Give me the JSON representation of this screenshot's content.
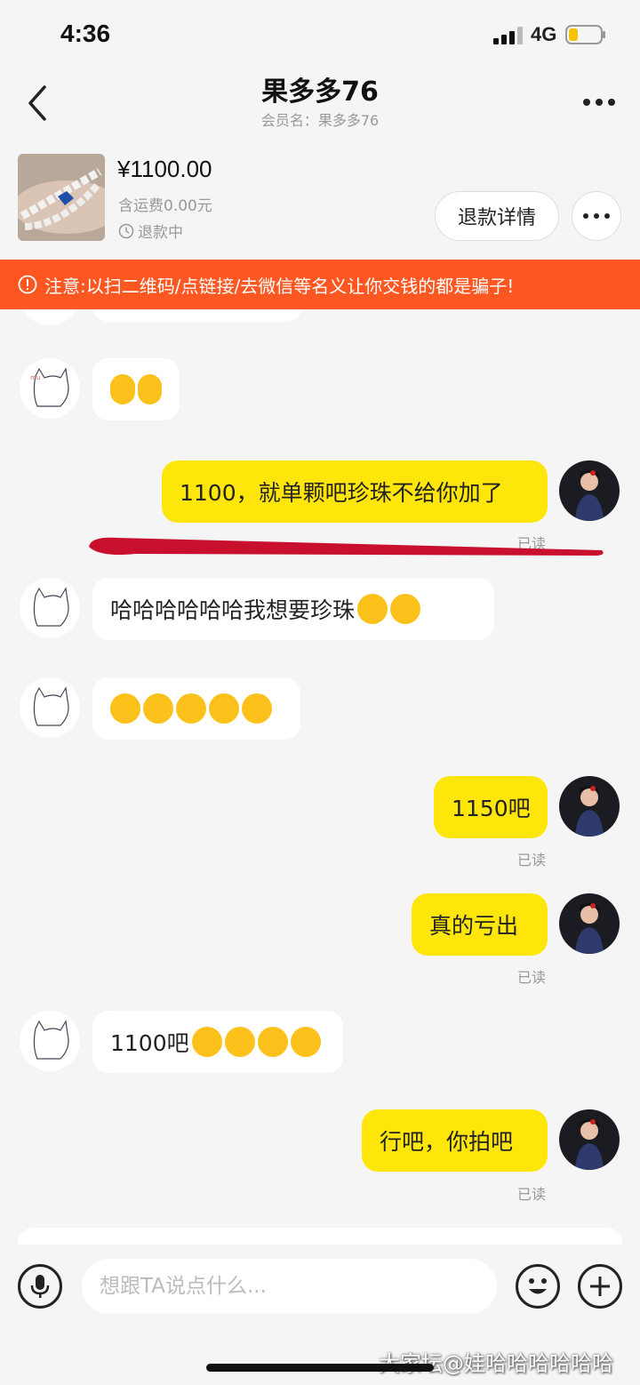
{
  "status_bar": {
    "time": "4:36",
    "network": "4G"
  },
  "header": {
    "title": "果多多76",
    "subtitle": "会员名：果多多76"
  },
  "product": {
    "price": "¥1100.00",
    "shipping": "含运费0.00元",
    "state": "退款中",
    "refund_button": "退款详情"
  },
  "warning": "注意:以扫二维码/点链接/去微信等名义让你交钱的都是骗子!",
  "messages": [
    {
      "dir": "in",
      "text": "",
      "emoji": [
        "laughing-crying",
        "laughing-crying"
      ]
    },
    {
      "dir": "out",
      "text": "1100，就单颗吧珍珠不给你加了",
      "emoji": [],
      "read": "已读"
    },
    {
      "dir": "in",
      "text": "哈哈哈哈哈哈我想要珍珠",
      "emoji": [
        "pleading",
        "pleading"
      ]
    },
    {
      "dir": "in",
      "text": "",
      "emoji": [
        "holding-back-tears",
        "holding-back-tears",
        "holding-back-tears",
        "holding-back-tears",
        "holding-back-tears"
      ]
    },
    {
      "dir": "out",
      "text": "1150吧",
      "emoji": [],
      "read": "已读"
    },
    {
      "dir": "out",
      "text": "真的亏出",
      "emoji": [],
      "read": "已读"
    },
    {
      "dir": "in",
      "text": "1100吧",
      "emoji": [
        "holding-back-tears",
        "holding-back-tears",
        "holding-back-tears",
        "holding-back-tears"
      ]
    },
    {
      "dir": "out",
      "text": "行吧，你拍吧",
      "emoji": [],
      "read": "已读"
    }
  ],
  "input": {
    "placeholder": "想跟TA说点什么..."
  },
  "watermark": "大家坛@娃哈哈哈哈哈哈",
  "colors": {
    "accent_yellow": "#ffe60a",
    "warning": "#ff5722",
    "annotation_red": "#c8102e"
  }
}
